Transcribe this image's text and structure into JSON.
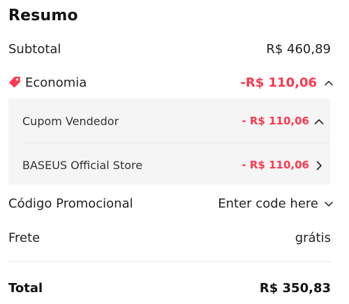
{
  "summary": {
    "title": "Resumo",
    "subtotal_label": "Subtotal",
    "subtotal_value": "R$ 460,89",
    "economia_label": "Economia",
    "economia_value": "-R$ 110,06",
    "economia_icon": "tag-icon",
    "discounts": [
      {
        "label": "Cupom Vendedor",
        "value": "- R$ 110,06",
        "icon": "chevron-up-icon"
      },
      {
        "label": "BASEUS Official Store",
        "value": "- R$ 110,06",
        "icon": "chevron-right-icon"
      }
    ],
    "promo_label": "Código Promocional",
    "promo_placeholder": "Enter code here",
    "frete_label": "Frete",
    "frete_value": "grátis",
    "total_label": "Total",
    "total_value": "R$ 350,83"
  },
  "colors": {
    "accent": "#fd384f",
    "panel_bg": "#f5f5f5",
    "text": "#222222"
  }
}
